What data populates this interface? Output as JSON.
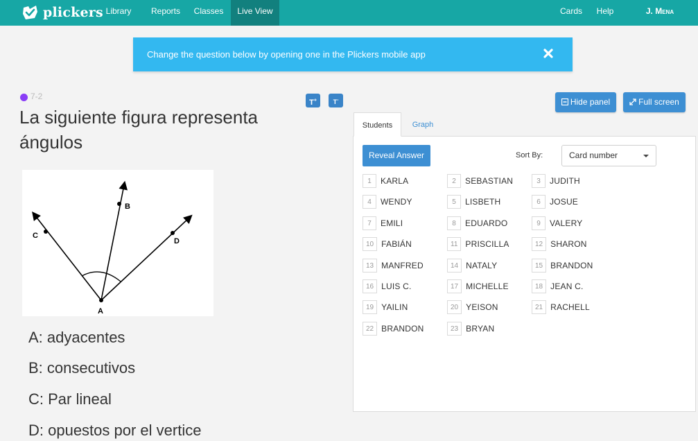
{
  "nav": {
    "brand": "plickers",
    "left_items": [
      {
        "label": "Library",
        "active": false
      },
      {
        "label": "Reports",
        "active": false
      },
      {
        "label": "Classes",
        "active": false
      },
      {
        "label": "Live View",
        "active": true
      }
    ],
    "right_items": [
      {
        "label": "Cards"
      },
      {
        "label": "Help"
      },
      {
        "label": "J. Mena"
      }
    ]
  },
  "banner": {
    "text": "Change the question below by opening one in the Plickers mobile app",
    "close_icon": "close-icon"
  },
  "question": {
    "class_name": "7-2",
    "class_color": "#8a3df6",
    "text": "La siguiente figura representa ángulos",
    "figure_labels": [
      "A",
      "B",
      "C",
      "D"
    ],
    "choices": [
      "A: adyacentes",
      "B: consecutivos",
      "C: Par lineal",
      "D: opuestos por el vertice"
    ]
  },
  "format_buttons": [
    "increase-text-size-icon",
    "decrease-text-size-icon"
  ],
  "actions": {
    "hide_panel": "Hide panel",
    "full_screen": "Full screen"
  },
  "tabs": [
    {
      "label": "Students",
      "active": true
    },
    {
      "label": "Graph",
      "active": false
    }
  ],
  "panel": {
    "reveal_answer": "Reveal Answer",
    "sort_by_label": "Sort By:",
    "sort_value": "Card number"
  },
  "students": [
    {
      "num": "1",
      "name": "KARLA"
    },
    {
      "num": "2",
      "name": "SEBASTIAN"
    },
    {
      "num": "3",
      "name": "JUDITH"
    },
    {
      "num": "4",
      "name": "WENDY"
    },
    {
      "num": "5",
      "name": "LISBETH"
    },
    {
      "num": "6",
      "name": "JOSUE"
    },
    {
      "num": "7",
      "name": "EMILI"
    },
    {
      "num": "8",
      "name": "EDUARDO"
    },
    {
      "num": "9",
      "name": "VALERY"
    },
    {
      "num": "10",
      "name": "FABIÁN"
    },
    {
      "num": "11",
      "name": "PRISCILLA"
    },
    {
      "num": "12",
      "name": "SHARON"
    },
    {
      "num": "13",
      "name": "MANFRED"
    },
    {
      "num": "14",
      "name": "NATALY"
    },
    {
      "num": "15",
      "name": "BRANDON"
    },
    {
      "num": "16",
      "name": "LUIS C."
    },
    {
      "num": "17",
      "name": "MICHELLE"
    },
    {
      "num": "18",
      "name": "JEAN C."
    },
    {
      "num": "19",
      "name": "YAILIN"
    },
    {
      "num": "20",
      "name": "YEISON"
    },
    {
      "num": "21",
      "name": "RACHELL"
    },
    {
      "num": "22",
      "name": "BRANDON"
    },
    {
      "num": "23",
      "name": "BRYAN"
    }
  ],
  "colors": {
    "topbar": "#17a7a5",
    "banner": "#33b8f0",
    "button": "#3d8fd3"
  }
}
